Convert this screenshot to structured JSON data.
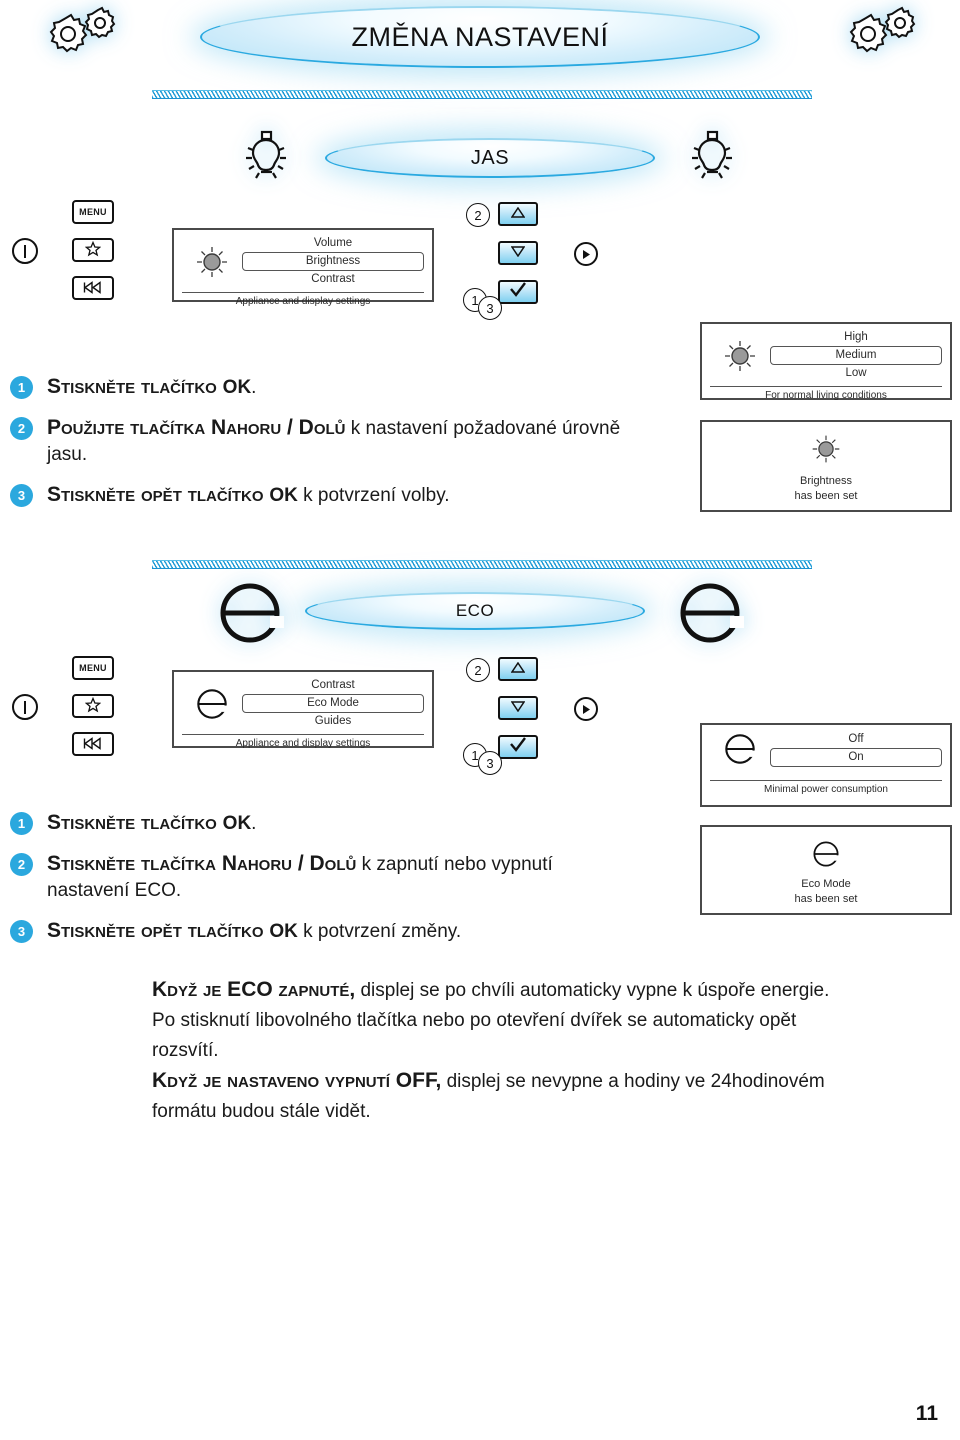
{
  "document": {
    "title": "ZMĚNA NASTAVENÍ",
    "page_number": "11",
    "accent_color": "#2ba8de",
    "panel_border_color": "#4a4a4a"
  },
  "sections": [
    {
      "id": "brightness",
      "heading": "JAS",
      "heading_icon": "lightbulb-icon",
      "menu_panel": {
        "glyph": "brightness-sun-icon",
        "options": [
          "Volume",
          "Brightness",
          "Contrast"
        ],
        "selected_index": 1,
        "footer": "Appliance and display settings"
      },
      "level_panel": {
        "glyph": "brightness-sun-icon",
        "options": [
          "High",
          "Medium",
          "Low"
        ],
        "selected_index": 1,
        "footer": "For normal living conditions"
      },
      "confirm_panel": {
        "glyph": "brightness-sun-icon",
        "line1": "Brightness",
        "line2": "has been set"
      },
      "steps": [
        {
          "num": "1",
          "caps": "Stiskněte tlačítko ",
          "bold": "OK",
          "rest": "."
        },
        {
          "num": "2",
          "caps": "Použijte tlačítka Nahoru / Dolů",
          "bold": "",
          "rest": " k nastavení požadované úrovně jasu."
        },
        {
          "num": "3",
          "caps": "Stiskněte opět tlačítko ",
          "bold": "OK",
          "rest": " k potvrzení volby."
        }
      ]
    },
    {
      "id": "eco",
      "heading": "ECO",
      "heading_icon": "eco-e-icon",
      "menu_panel": {
        "glyph": "eco-e-icon",
        "options": [
          "Contrast",
          "Eco Mode",
          "Guides"
        ],
        "selected_index": 1,
        "footer": "Appliance and display settings"
      },
      "level_panel": {
        "glyph": "eco-e-icon",
        "options": [
          "Off",
          "On"
        ],
        "selected_index": 1,
        "footer": "Minimal power consumption"
      },
      "confirm_panel": {
        "glyph": "eco-e-icon",
        "line1": "Eco Mode",
        "line2": "has been set"
      },
      "steps": [
        {
          "num": "1",
          "caps": "Stiskněte tlačítko ",
          "bold": "OK",
          "rest": "."
        },
        {
          "num": "2",
          "caps": "Stiskněte tlačítka  Nahoru / Dolů",
          "bold": "",
          "rest": " k zapnutí nebo vypnutí nastavení ECO."
        },
        {
          "num": "3",
          "caps": "Stiskněte opět tlačítko ",
          "bold": "OK",
          "rest": "  k potvrzení změny."
        }
      ]
    }
  ],
  "device_keys": {
    "power_label": "power-button",
    "menu_label": "MENU",
    "favorite_label": "star-icon",
    "rewind_label": "rewind-icon"
  },
  "nav_keys": {
    "up_label": "up-arrow-icon",
    "down_label": "down-arrow-icon",
    "ok_label": "checkmark-icon",
    "play_label": "play-icon",
    "step_up": "2",
    "step_ok_a": "1",
    "step_ok_b": "3"
  },
  "bottom_note": {
    "para1_caps": "Když je ECO zapnuté,",
    "para1_rest": " displej se po chvíli automaticky vypne k úspoře energie. Po stisknutí libovolného tlačítka nebo po otevření dvířek se automaticky opět rozsvítí.",
    "para2_caps": "Když je nastaveno vypnutí OFF,",
    "para2_rest": " displej se nevypne a hodiny ve 24hodinovém formátu budou stále vidět."
  }
}
